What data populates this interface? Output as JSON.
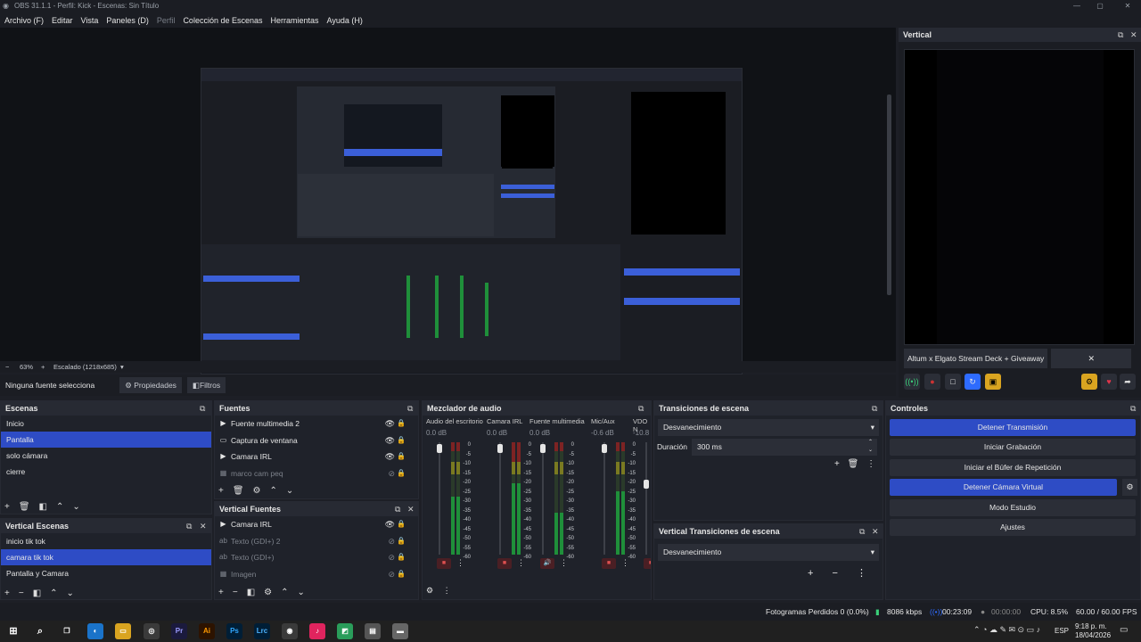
{
  "window": {
    "title": "OBS 31.1.1 - Perfil: Kick - Escenas: Sin Título",
    "minimize": "—",
    "maximize": "▢",
    "close": "✕"
  },
  "menu": [
    "Archivo (F)",
    "Editar",
    "Vista",
    "Paneles (D)",
    "Perfil",
    "Colección de Escenas",
    "Herramientas",
    "Ayuda (H)"
  ],
  "zoom": {
    "minus": "−",
    "value": "63%",
    "plus": "+",
    "mode": "Escalado (1218x685)"
  },
  "source_bar": {
    "label": "Ninguna fuente selecciona",
    "properties": "Propiedades",
    "filters": "Filtros"
  },
  "vertical": {
    "title": "Vertical",
    "tab_label": "Altum x Elgato Stream Deck + Giveaway",
    "close": "✕"
  },
  "scenes": {
    "title": "Escenas",
    "items": [
      "Inicio",
      "Pantalla",
      "solo cámara",
      "cierre"
    ],
    "selected": "Pantalla"
  },
  "vertical_scenes": {
    "title": "Vertical Escenas",
    "items": [
      "inicio tik tok",
      "camara tik tok",
      "Pantalla y Camara"
    ],
    "selected": "camara tik tok"
  },
  "sources": {
    "title": "Fuentes",
    "items": [
      {
        "name": "Fuente multimedia 2",
        "icon": "▶",
        "dim": false
      },
      {
        "name": "Captura de ventana",
        "icon": "▭",
        "dim": false
      },
      {
        "name": "Camara IRL",
        "icon": "▶",
        "dim": false
      },
      {
        "name": "marco cam peq",
        "icon": "▦",
        "dim": true
      }
    ]
  },
  "vertical_sources": {
    "title": "Vertical Fuentes",
    "items": [
      {
        "name": "Camara IRL",
        "icon": "▶",
        "dim": false
      },
      {
        "name": "Texto (GDI+) 2",
        "icon": "ab",
        "dim": true
      },
      {
        "name": "Texto (GDI+)",
        "icon": "ab",
        "dim": true
      },
      {
        "name": "Imagen",
        "icon": "▦",
        "dim": true
      }
    ]
  },
  "mixer": {
    "title": "Mezclador de audio",
    "channels": [
      {
        "name": "Audio del escritorio",
        "db": "0.0 dB"
      },
      {
        "name": "Camara IRL",
        "db": "0.0 dB"
      },
      {
        "name": "Fuente multimedia",
        "db": "0.0 dB"
      },
      {
        "name": "Mic/Aux",
        "db": "-0.6 dB"
      },
      {
        "name": "VDO N",
        "db": "-10.8"
      }
    ],
    "scale": [
      "0",
      "-5",
      "-10",
      "-15",
      "-20",
      "-25",
      "-30",
      "-35",
      "-40",
      "-45",
      "-50",
      "-55",
      "-60"
    ]
  },
  "transitions": {
    "title": "Transiciones de escena",
    "type": "Desvanecimiento",
    "duration_label": "Duración",
    "duration_value": "300 ms"
  },
  "vertical_transitions": {
    "title": "Vertical Transiciones de escena",
    "type": "Desvanecimiento"
  },
  "controls": {
    "title": "Controles",
    "stop_stream": "Detener Transmisión",
    "start_record": "Iniciar Grabación",
    "replay_buffer": "Iniciar el Búfer de Repetición",
    "stop_virtual_cam": "Detener Cámara Virtual",
    "studio_mode": "Modo Estudio",
    "settings": "Ajustes"
  },
  "status": {
    "dropped": "Fotogramas Perdidos 0 (0.0%)",
    "bitrate": "8086 kbps",
    "stream_time": "00:23:09",
    "rec_time": "00:00:00",
    "cpu": "CPU: 8.5%",
    "fps": "60.00 / 60.00 FPS"
  },
  "taskbar": {
    "apps": [
      "Pr",
      "Ai",
      "Ps",
      "Lrc"
    ],
    "lang": "ESP",
    "time": "9:18 p. m.",
    "date": "18/04/2026"
  },
  "colors": {
    "accent": "#2e4cc5",
    "bg": "#1d1f26",
    "panel": "#1f222a"
  }
}
